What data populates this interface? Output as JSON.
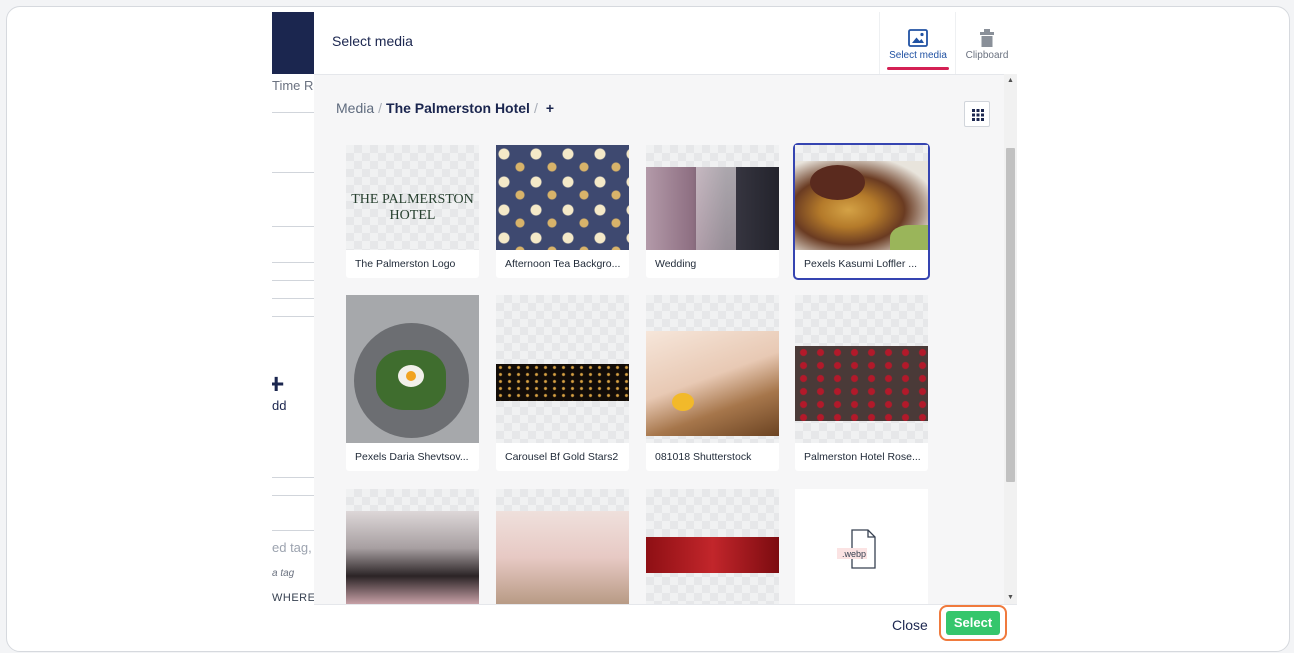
{
  "background_app": {
    "header_fragment": "Time Re",
    "add_label": "dd",
    "tag_placeholder": "ed tag, a",
    "tag_hint": "a tag",
    "where_label": "WHERE"
  },
  "dialog": {
    "title": "Select media",
    "app_tabs": [
      {
        "label": "Select media",
        "icon": "image-icon",
        "active": true
      },
      {
        "label": "Clipboard",
        "icon": "clipboard-icon",
        "active": false
      }
    ],
    "breadcrumb": {
      "root": "Media",
      "separator": "/",
      "current": "The Palmerston Hotel",
      "add": "+"
    },
    "items": [
      {
        "label": "The Palmerston Logo",
        "logo_text_line1": "THE PALMERSTON",
        "logo_text_line2": "HOTEL",
        "selected": false
      },
      {
        "label": "Afternoon Tea Backgro...",
        "selected": false
      },
      {
        "label": "Wedding",
        "selected": false
      },
      {
        "label": "Pexels Kasumi Loffler ...",
        "selected": true
      },
      {
        "label": "Pexels Daria Shevtsov...",
        "selected": false
      },
      {
        "label": "Carousel Bf Gold Stars2",
        "selected": false
      },
      {
        "label": "081018 Shutterstock",
        "selected": false
      },
      {
        "label": "Palmerston Hotel Rose...",
        "selected": false
      },
      {
        "label": "",
        "selected": false
      },
      {
        "label": "",
        "selected": false
      },
      {
        "label": "",
        "selected": false
      },
      {
        "label": "",
        "file_ext": ".webp",
        "selected": false
      }
    ],
    "footer": {
      "close_label": "Close",
      "select_label": "Select"
    }
  },
  "colors": {
    "accent_navy": "#1b264f",
    "tab_active_underline": "#d42054",
    "select_button": "#35c66c",
    "select_highlight": "#f07a3d",
    "selected_card_border": "#3544b1"
  }
}
